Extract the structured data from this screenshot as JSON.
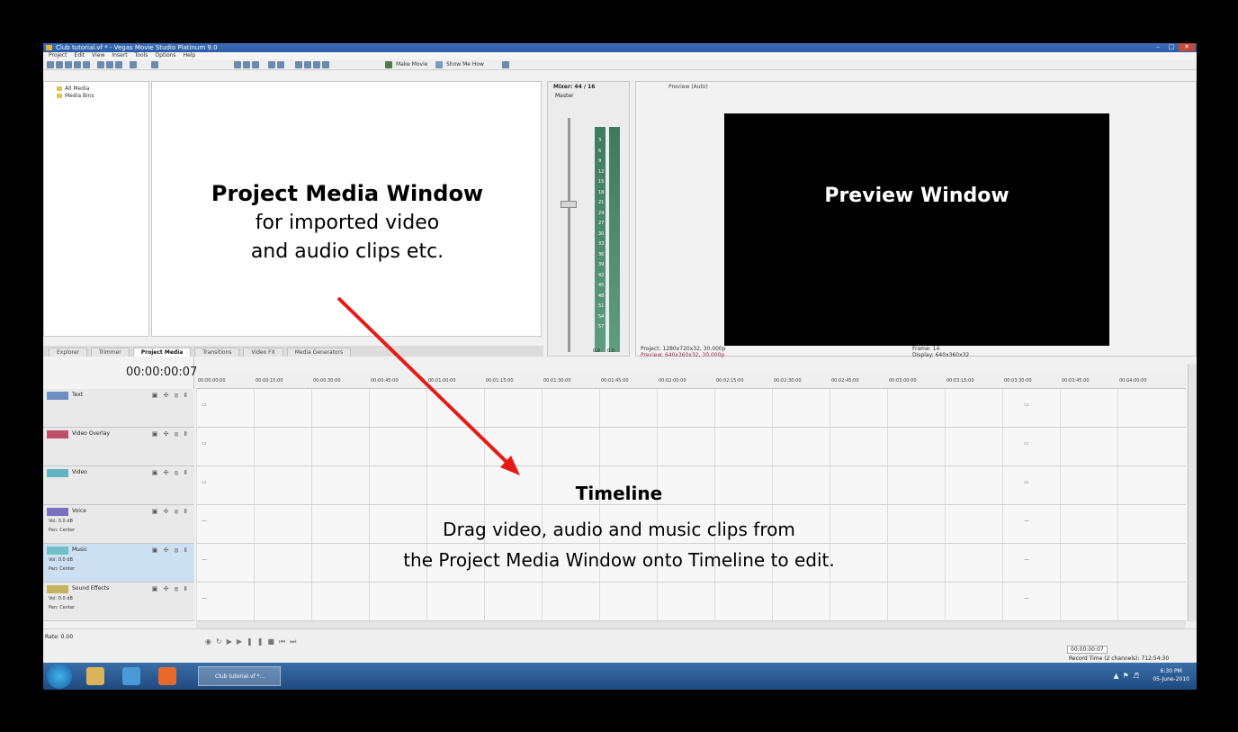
{
  "window": {
    "title": "Club tutorial.vf * - Vegas Movie Studio Platinum 9.0"
  },
  "menu": [
    "Project",
    "Edit",
    "View",
    "Insert",
    "Tools",
    "Options",
    "Help"
  ],
  "toolbar": {
    "make_movie_label": "Make Movie",
    "show_me_how_label": "Show Me How"
  },
  "explorer_tree": {
    "items": [
      "All Media",
      "Media Bins"
    ]
  },
  "project_media": {
    "title": "Project Media Window",
    "line1": "for imported video",
    "line2": "and audio clips etc."
  },
  "tabs": [
    "Explorer",
    "Trimmer",
    "Project Media",
    "Transitions",
    "Video FX",
    "Media Generators"
  ],
  "mixer": {
    "title": "Mixer: 44 / 16",
    "master_label": "Master",
    "left_val": "0.0",
    "right_val": "0.0",
    "scale": [
      "3",
      "6",
      "9",
      "12",
      "15",
      "18",
      "21",
      "24",
      "27",
      "30",
      "33",
      "36",
      "39",
      "42",
      "45",
      "48",
      "51",
      "54",
      "57"
    ]
  },
  "preview": {
    "toolbar_label": "Preview (Auto)",
    "label": "Preview Window",
    "project_info": "Project:  1280x720x32, 30.000p",
    "preview_info": "Preview:  640x360x32, 30.000p",
    "frame_info": "Frame:  14",
    "display_info": "Display:  640x360x32"
  },
  "timeline": {
    "timecode": "00:00:00:07",
    "ruler": [
      "00:00:00:00",
      "00:00:15:00",
      "00:00:30:00",
      "00:00:45:00",
      "00:01:00:00",
      "00:01:15:00",
      "00:01:30:00",
      "00:01:45:00",
      "00:02:00:00",
      "00:02:15:00",
      "00:02:30:00",
      "00:02:45:00",
      "00:03:00:00",
      "00:03:15:00",
      "00:03:30:00",
      "00:03:45:00",
      "00:04:00:00"
    ],
    "tracks": [
      {
        "name": "Text",
        "color": "#6c8fc4"
      },
      {
        "name": "Video Overlay",
        "color": "#c0506a"
      },
      {
        "name": "Video",
        "color": "#5fb3c4"
      },
      {
        "name": "Voice",
        "color": "#7a6fc0",
        "vol": "Vol:    0.0 dB",
        "pan": "Pan:   Center"
      },
      {
        "name": "Music",
        "color": "#6fbfc4",
        "vol": "Vol:    0.0 dB",
        "pan": "Pan:   Center"
      },
      {
        "name": "Sound Effects",
        "color": "#c4b45f",
        "vol": "Vol:    0.0 dB",
        "pan": "Pan:   Center"
      }
    ],
    "heading": "Timeline",
    "line1": "Drag video, audio and music clips from",
    "line2": "the Project Media Window onto Timeline to edit."
  },
  "transport": {
    "rate": "Rate: 0.00",
    "end_timecode": "00:00:00:07",
    "record_time": "Record Time (2 channels): 712:54:30"
  },
  "taskbar": {
    "task_label": "Club tutorial.vf *...",
    "time": "6:30 PM",
    "date": "05-June-2010"
  },
  "colors": {
    "arrow": "#e41b17",
    "titlebar": "#2a5ea7",
    "preview_bg": "#000000"
  }
}
